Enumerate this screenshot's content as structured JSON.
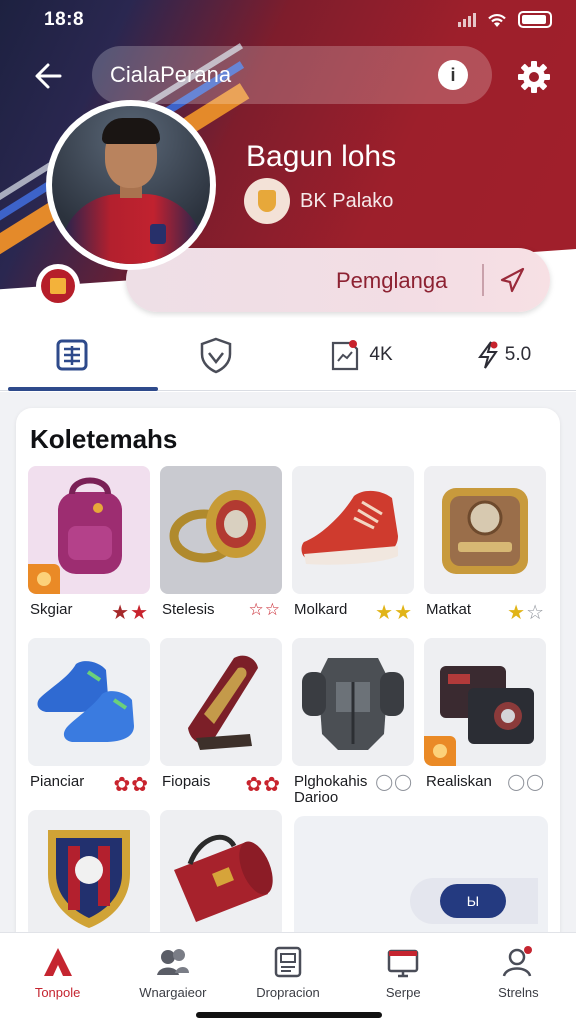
{
  "status_bar": {
    "time": "18:8"
  },
  "header": {
    "search_text": "CialaPerana",
    "info_glyph": "i"
  },
  "profile": {
    "name": "Bagun lohs",
    "team_name": "BK Palako",
    "follow_label": "Pemglanga"
  },
  "tabs": [
    {
      "name": "list-tab",
      "icon": "list-icon",
      "label": ""
    },
    {
      "name": "shield-tab",
      "icon": "shield-icon",
      "label": ""
    },
    {
      "name": "stats-tab",
      "icon": "chart-note-icon",
      "label": "4K"
    },
    {
      "name": "score-tab",
      "icon": "lightning-icon",
      "label": "5.0"
    }
  ],
  "collection": {
    "title": "Koletemahs",
    "items": [
      {
        "name": "Skgiar",
        "rating": "★★"
      },
      {
        "name": "Stelesis",
        "rating": "★★"
      },
      {
        "name": "Molkard",
        "rating": "★★"
      },
      {
        "name": "Matkat",
        "rating": "★☆"
      },
      {
        "name": "Pianciar",
        "rating": "✿✿"
      },
      {
        "name": "Fiopais",
        "rating": "✿✿"
      },
      {
        "name": "Plghokahis Darioo",
        "rating": "◯◯"
      },
      {
        "name": "Realiskan",
        "rating": "◯◯"
      },
      {
        "name": "",
        "rating": ""
      },
      {
        "name": "",
        "rating": ""
      }
    ],
    "more_label": "Ы"
  },
  "bottom_nav": [
    {
      "label": "Tonpole",
      "icon": "home-icon",
      "active": true
    },
    {
      "label": "Wnargaieor",
      "icon": "people-icon",
      "active": false
    },
    {
      "label": "Dropracion",
      "icon": "document-icon",
      "active": false
    },
    {
      "label": "Serpe",
      "icon": "tv-icon",
      "active": false
    },
    {
      "label": "Strelns",
      "icon": "profile-icon",
      "active": false
    }
  ],
  "colors": {
    "brand_red": "#9d1f2b",
    "navy": "#243a80",
    "accent_orange": "#e48a2a"
  }
}
